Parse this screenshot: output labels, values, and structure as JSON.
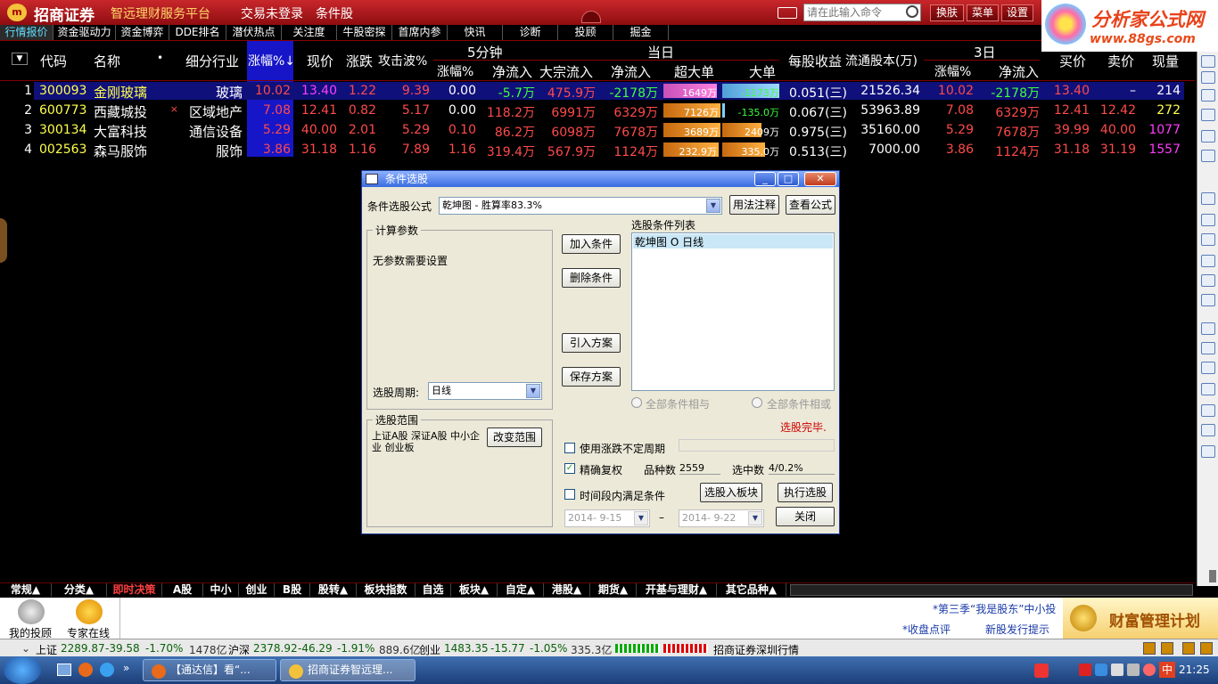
{
  "titlebar": {
    "logo_mark": "m",
    "brand": "招商证券",
    "platform": "智远理财服务平台",
    "login": "交易未登录",
    "cond_pick": "条件股",
    "cmd_placeholder": "请在此输入命令",
    "buttons": [
      "换肤",
      "菜单",
      "设置"
    ]
  },
  "watermark": {
    "line1": "分析家公式网",
    "line2": "www.88gs.com"
  },
  "nav": [
    "行情报价",
    "资金驱动力",
    "资金博弈",
    "DDE排名",
    "潜伏热点",
    "关注度",
    "牛股密探",
    "首席内参",
    "快讯",
    "诊断",
    "投顾",
    "掘金"
  ],
  "header": {
    "code": "代码",
    "name": "名称",
    "industry": "细分行业",
    "change": "涨幅%↓",
    "price": "现价",
    "updown": "涨跌",
    "attack": "攻击波%",
    "g5": "5分钟",
    "g5_change": "涨幅%",
    "g5_flow": "净流入",
    "block_flow": "大宗流入",
    "today": "当日",
    "today_flow": "净流入",
    "super_big": "超大单",
    "big": "大单",
    "eps": "每股收益",
    "float_shares": "流通股本(万)",
    "g3": "3日",
    "g3_change": "涨幅%",
    "g3_flow": "净流入",
    "bid": "买价",
    "ask": "卖价",
    "volume": "现量"
  },
  "rows": [
    {
      "no": "1",
      "code": "300093",
      "name": "金刚玻璃",
      "mark": "",
      "industry": "玻璃",
      "change": "10.02",
      "price": "13.40",
      "updown": "1.22",
      "attack": "9.39",
      "g5_change": "0.00",
      "g5_flow": "-5.7万",
      "block": "475.9万",
      "today_flow": "-2178万",
      "super": "1649万",
      "big": "-1173万",
      "eps": "0.051(三)",
      "float": "21526.34",
      "g3_change": "10.02",
      "g3_flow": "-2178万",
      "bid": "13.40",
      "ask": "–",
      "vol": "214"
    },
    {
      "no": "2",
      "code": "600773",
      "name": "西藏城投",
      "mark": "×",
      "industry": "区域地产",
      "change": "7.08",
      "price": "12.41",
      "updown": "0.82",
      "attack": "5.17",
      "g5_change": "0.00",
      "g5_flow": "118.2万",
      "block": "6991万",
      "today_flow": "6329万",
      "super": "7126万",
      "big": "-135.0万",
      "eps": "0.067(三)",
      "float": "53963.89",
      "g3_change": "7.08",
      "g3_flow": "6329万",
      "bid": "12.41",
      "ask": "12.42",
      "vol": "272"
    },
    {
      "no": "3",
      "code": "300134",
      "name": "大富科技",
      "mark": "",
      "industry": "通信设备",
      "change": "5.29",
      "price": "40.00",
      "updown": "2.01",
      "attack": "5.29",
      "g5_change": "0.10",
      "g5_flow": "86.2万",
      "block": "6098万",
      "today_flow": "7678万",
      "super": "3689万",
      "big": "2409万",
      "eps": "0.975(三)",
      "float": "35160.00",
      "g3_change": "5.29",
      "g3_flow": "7678万",
      "bid": "39.99",
      "ask": "40.00",
      "vol": "1077"
    },
    {
      "no": "4",
      "code": "002563",
      "name": "森马服饰",
      "mark": "",
      "industry": "服饰",
      "change": "3.86",
      "price": "31.18",
      "updown": "1.16",
      "attack": "7.89",
      "g5_change": "1.16",
      "g5_flow": "319.4万",
      "block": "567.9万",
      "today_flow": "1124万",
      "super": "232.9万",
      "big": "335.0万",
      "eps": "0.513(三)",
      "float": "7000.00",
      "g3_change": "3.86",
      "g3_flow": "1124万",
      "bid": "31.18",
      "ask": "31.19",
      "vol": "1557"
    }
  ],
  "dialog": {
    "title": "条件选股",
    "formula_label": "条件选股公式",
    "formula_value": "乾坤图  - 胜算率83.3%",
    "usage_btn": "用法注释",
    "view_btn": "查看公式",
    "params_title": "计算参数",
    "no_params": "无参数需要设置",
    "add_btn": "加入条件",
    "del_btn": "删除条件",
    "import_btn": "引入方案",
    "save_btn": "保存方案",
    "list_title": "选股条件列表",
    "list_items": [
      "乾坤图  O  日线"
    ],
    "period_label": "选股周期:",
    "period_value": "日线",
    "radio_and": "全部条件相与",
    "radio_or": "全部条件相或",
    "status": "选股完毕.",
    "range_title": "选股范围",
    "range_text": "上证A股 深证A股 中小企业 创业板",
    "change_range_btn": "改变范围",
    "chk_uncertain": "使用涨跌不定周期",
    "chk_rights": "精确复权",
    "count_label": "品种数",
    "count_value": "2559",
    "selected_label": "选中数",
    "selected_value": "4/0.2%",
    "chk_time": "时间段内满足条件",
    "to_block_btn": "选股入板块",
    "exec_btn": "执行选股",
    "date_from": "2014- 9-15",
    "date_sep": "–",
    "date_to": "2014- 9-22",
    "close_btn": "关闭"
  },
  "tabs": [
    "常规▲",
    "分类▲",
    "即时决策",
    "A股",
    "中小",
    "创业",
    "B股",
    "股转▲",
    "板块指数",
    "自选",
    "板块▲",
    "自定▲",
    "港股▲",
    "期货▲",
    "开基与理财▲",
    "其它品种▲"
  ],
  "info": {
    "advisor": "我的投顾",
    "expert": "专家在线",
    "ticker1": "*第三季“我是股东”中小投",
    "ticker2": "*收盘点评",
    "ticker3": "新股发行提示",
    "banner": "财富管理计划"
  },
  "index": {
    "sh_label": "上证",
    "sh": "2289.87",
    "sh_ch": "-39.58",
    "sh_pct": "-1.70%",
    "sh_amt": "1478亿",
    "hs_label": "沪深",
    "hs": "2378.92",
    "hs_ch": "-46.29",
    "hs_pct": "-1.91%",
    "hs_amt": "889.6亿",
    "cy_label": "创业",
    "cy": "1483.35",
    "cy_ch": "-15.77",
    "cy_pct": "-1.05%",
    "cy_amt": "335.3亿",
    "feed": "招商证券深圳行情"
  },
  "taskbar": {
    "task1": "【通达信】看“...",
    "task2": "招商证券智远理...",
    "clock": "21:25",
    "ime": "中"
  }
}
